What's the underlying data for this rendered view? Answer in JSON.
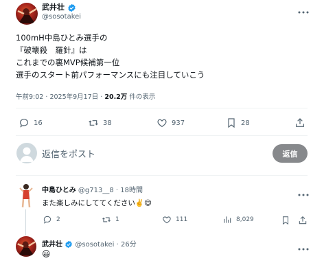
{
  "main_tweet": {
    "author_name": "武井壮",
    "handle": "@sosotakei",
    "lines": [
      "100mH中島ひとみ選手の",
      "『破壊殺　羅針』は",
      "これまでの裏MVP候補第一位",
      "選手のスタート前パフォーマンスにも注目していこう"
    ],
    "meta": {
      "time": "午前9:02",
      "dot": "·",
      "date": "2025年9月17日",
      "dot2": "·",
      "views_count": "20.2万",
      "views_label": "件の表示"
    },
    "actions": {
      "reply_count": "16",
      "retweet_count": "38",
      "like_count": "937",
      "bookmark_count": "28"
    }
  },
  "reply_composer": {
    "placeholder": "返信をポスト",
    "button_label": "返信"
  },
  "replies": [
    {
      "author_name": "中島ひとみ",
      "handle": "@g713__8",
      "dot": "·",
      "time_ago": "18時間",
      "text": "また楽しみにしててください",
      "emoji": "✌️😌",
      "actions": {
        "reply_count": "2",
        "retweet_count": "1",
        "like_count": "111",
        "views_count": "8,029"
      }
    },
    {
      "author_name": "武井壮",
      "handle": "@sosotakei",
      "dot": "·",
      "time_ago": "26分",
      "emoji": "😃"
    }
  ],
  "colors": {
    "verified": "#1d9bf0",
    "reply_button_bg": "#87898c",
    "text": "#0f1419",
    "muted": "#536471"
  },
  "icons": [
    "more-icon",
    "verified-badge-icon",
    "reply-icon",
    "retweet-icon",
    "like-icon",
    "views-icon",
    "bookmark-icon",
    "share-icon"
  ]
}
